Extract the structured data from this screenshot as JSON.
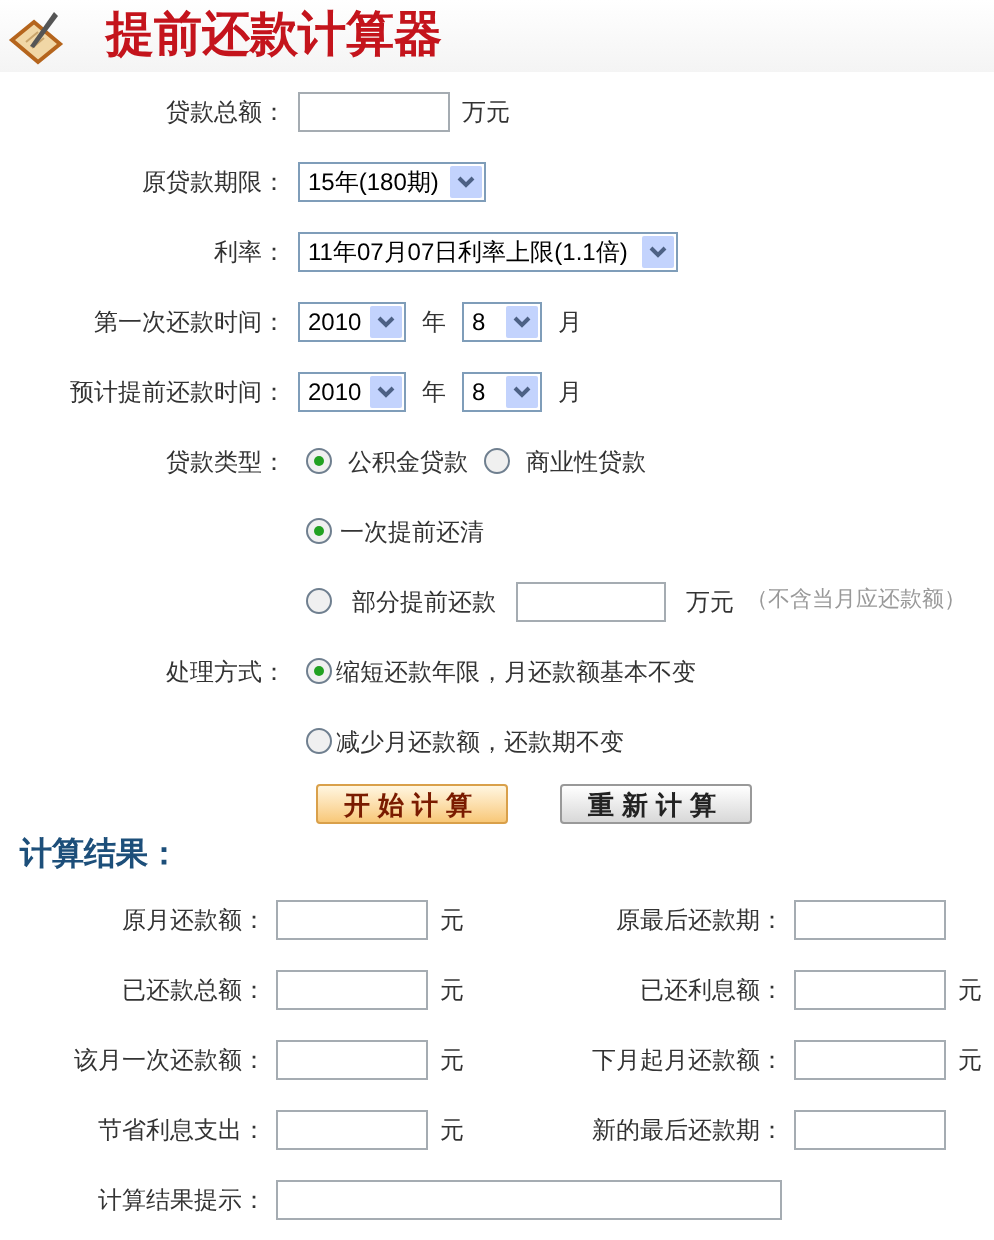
{
  "title": "提前还款计算器",
  "form": {
    "loan_amount": {
      "label": "贷款总额：",
      "unit": "万元"
    },
    "term": {
      "label": "原贷款期限：",
      "value": "15年(180期)"
    },
    "rate": {
      "label": "利率：",
      "value": "11年07月07日利率上限(1.1倍)"
    },
    "first_payment": {
      "label": "第一次还款时间：",
      "year": "2010",
      "year_unit": "年",
      "month": "8",
      "month_unit": "月"
    },
    "prepay_time": {
      "label": "预计提前还款时间：",
      "year": "2010",
      "year_unit": "年",
      "month": "8",
      "month_unit": "月"
    },
    "loan_type": {
      "label": "贷款类型：",
      "options": [
        {
          "label": "公积金贷款",
          "selected": true
        },
        {
          "label": "商业性贷款",
          "selected": false
        }
      ]
    },
    "prepay_mode": {
      "options": [
        {
          "kind": "plain",
          "label": "一次提前还清",
          "selected": true
        },
        {
          "kind": "amount",
          "label": "部分提前还款",
          "unit": "万元",
          "note": "（不含当月应还款额）",
          "selected": false
        }
      ]
    },
    "handling": {
      "label": "处理方式：",
      "options": [
        {
          "label": "缩短还款年限，月还款额基本不变",
          "selected": true
        },
        {
          "label": "减少月还款额，还款期不变",
          "selected": false
        }
      ]
    }
  },
  "buttons": [
    {
      "kind": "primary",
      "label": "开始计算"
    },
    {
      "kind": "secondary",
      "label": "重新计算"
    }
  ],
  "results": {
    "title": "计算结果：",
    "rows": [
      [
        {
          "label": "原月还款额：",
          "unit": "元"
        },
        {
          "label": "原最后还款期："
        }
      ],
      [
        {
          "label": "已还款总额：",
          "unit": "元"
        },
        {
          "label": "已还利息额：",
          "unit": "元"
        }
      ],
      [
        {
          "label": "该月一次还款额：",
          "unit": "元"
        },
        {
          "label": "下月起月还款额：",
          "unit": "元"
        }
      ],
      [
        {
          "label": "节省利息支出：",
          "unit": "元"
        },
        {
          "label": "新的最后还款期："
        }
      ]
    ],
    "hint": {
      "label": "计算结果提示："
    }
  }
}
